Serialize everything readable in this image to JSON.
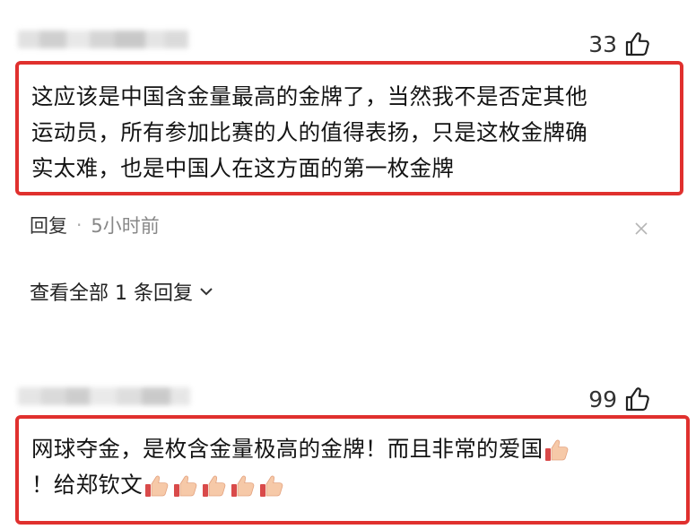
{
  "comments": [
    {
      "likes": "33",
      "text": "这应该是中国含金量最高的金牌了，当然我不是否定其他运动员，所有参加比赛的人的值得表扬，只是这枚金牌确实太难，也是中国人在这方面的第一枚金牌",
      "lines": [
        "这应该是中国含金量最高的金牌了，当然我不是否定其他",
        "运动员，所有参加比赛的人的值得表扬，只是这枚金牌确",
        "实太难，也是中国人在这方面的第一枚金牌"
      ],
      "reply_label": "回复",
      "separator": "·",
      "time": "5小时前",
      "view_replies": "查看全部 1 条回复"
    },
    {
      "likes": "99",
      "line1": "网球夺金，是枚含金量极高的金牌！而且非常的爱国",
      "line2": "！给郑钦文"
    }
  ],
  "icons": {
    "like": "thumbs-up-outline-icon",
    "emoji": "thumbs-up-emoji",
    "close": "close-icon",
    "chevron": "chevron-down-icon"
  },
  "colors": {
    "highlight": "#e0302e",
    "text": "#141414",
    "muted": "#888888"
  }
}
